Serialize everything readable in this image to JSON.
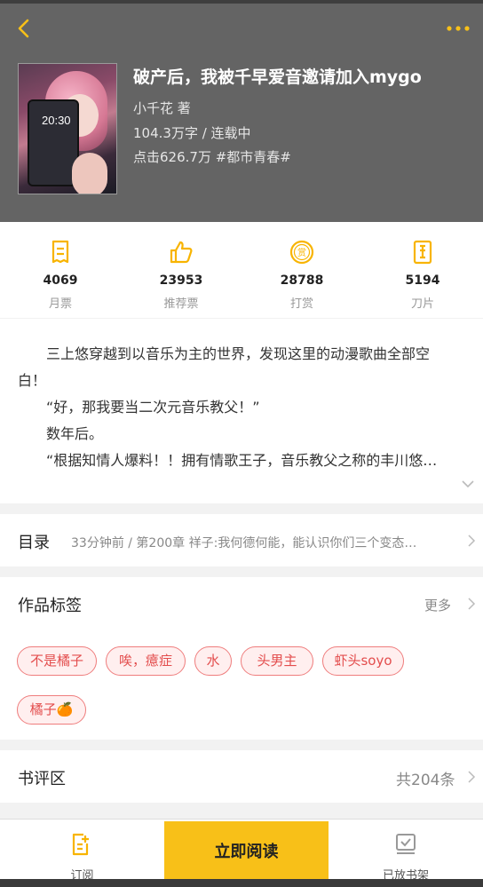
{
  "header": {
    "title": "破产后，我被千早爱音邀请加入mygo",
    "author": "小千花 著",
    "words": "104.3万字 / 连载中",
    "clicks": "点击626.7万  #都市青春#",
    "cover_text": "20:30",
    "accent_color": "#f8c018",
    "back_icon": "chevron-left-icon",
    "more_icon": "more-dots-icon"
  },
  "stats": [
    {
      "value": "4069",
      "label": "月票",
      "icon": "ticket-icon"
    },
    {
      "value": "23953",
      "label": "推荐票",
      "icon": "thumbs-up-icon"
    },
    {
      "value": "28788",
      "label": "打赏",
      "icon": "reward-coin-icon"
    },
    {
      "value": "5194",
      "label": "刀片",
      "icon": "blade-icon"
    }
  ],
  "synopsis": {
    "line1": "三上悠穿越到以音乐为主的世界，发现这里的动漫歌曲全部空",
    "line2": "白！",
    "line3": "“好，那我要当二次元音乐教父！”",
    "line4": "数年后。",
    "line5": "“根据知情人爆料！！拥有情歌王子，音乐教父之称的丰川悠…"
  },
  "toc": {
    "title": "目录",
    "latest": "33分钟前 / 第200章 祥子:我何德何能，能认识你们三个变态…"
  },
  "tags": {
    "title": "作品标签",
    "more": "更多",
    "items": [
      "不是橘子",
      "唉，癔症",
      "水",
      "头男主",
      "虾头soyo",
      "橘子🍊"
    ],
    "tag_color": "#e34d4d"
  },
  "review": {
    "title": "书评区",
    "count": "共204条"
  },
  "bottom": {
    "subscribe": "订阅",
    "read_now": "立即阅读",
    "shelf": "已放书架"
  }
}
